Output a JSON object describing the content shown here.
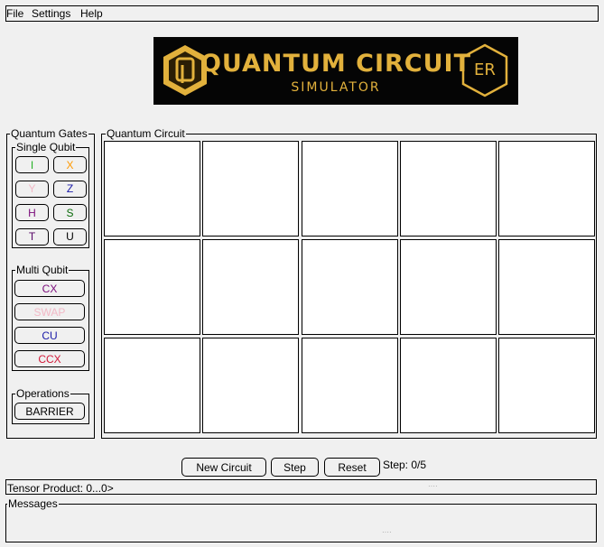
{
  "menu": [
    "File",
    "Settings",
    "Help"
  ],
  "banner": {
    "title": "QUANTUM CIRCUIT",
    "subtitle": "SIMULATOR",
    "badge": "ER",
    "accent_color": "#e2b13c"
  },
  "gates_panel": {
    "title": "Quantum Gates",
    "single": {
      "title": "Single Qubit",
      "gates": [
        {
          "label": "I",
          "color": "#22b022"
        },
        {
          "label": "X",
          "color": "#ff9900"
        },
        {
          "label": "Y",
          "color": "#f2b8c6"
        },
        {
          "label": "Z",
          "color": "#1a1aa8"
        },
        {
          "label": "H",
          "color": "#7a0a7a"
        },
        {
          "label": "S",
          "color": "#0a6a0a"
        },
        {
          "label": "T",
          "color": "#5a0a6a"
        },
        {
          "label": "U",
          "color": "#000000"
        }
      ]
    },
    "multi": {
      "title": "Multi Qubit",
      "gates": [
        {
          "label": "CX",
          "color": "#7a0a7a"
        },
        {
          "label": "SWAP",
          "color": "#f2b8c6"
        },
        {
          "label": "CU",
          "color": "#1a1aa8"
        },
        {
          "label": "CCX",
          "color": "#d21a3a"
        }
      ]
    },
    "operations": {
      "title": "Operations",
      "gates": [
        {
          "label": "BARRIER",
          "color": "#000000"
        }
      ]
    }
  },
  "circuit": {
    "title": "Quantum Circuit",
    "rows": 3,
    "cols": 5
  },
  "controls": {
    "new_circuit": "New Circuit",
    "step": "Step",
    "reset": "Reset",
    "step_status": "Step: 0/5"
  },
  "tensor_product": "Tensor Product: 0...0>",
  "messages": {
    "title": "Messages"
  }
}
